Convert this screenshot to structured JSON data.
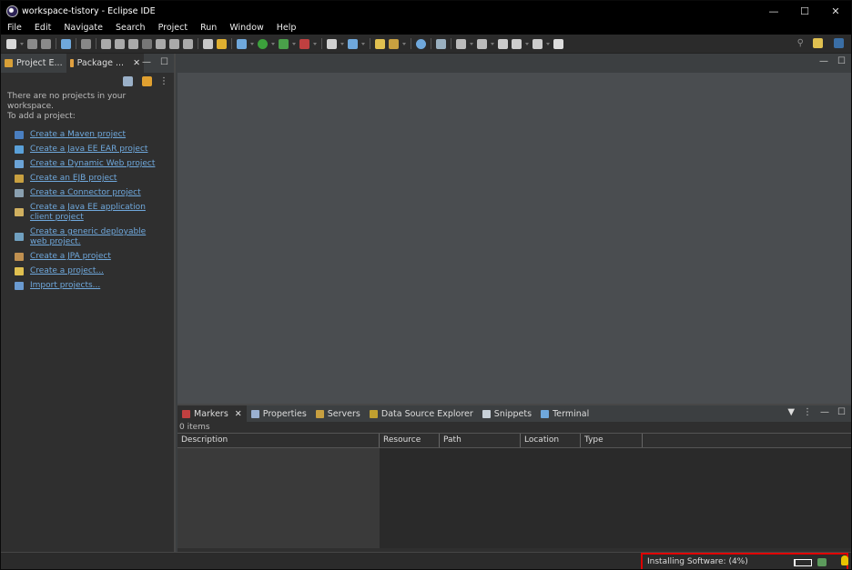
{
  "window": {
    "title": "workspace-tistory - Eclipse IDE",
    "controls": [
      "—",
      "☐",
      "✕"
    ]
  },
  "menu": [
    "File",
    "Edit",
    "Navigate",
    "Search",
    "Project",
    "Run",
    "Window",
    "Help"
  ],
  "left_panel": {
    "tabs": [
      {
        "label": "Project E..."
      },
      {
        "label": "Package ...",
        "close": "✕"
      }
    ],
    "controls": [
      "—",
      "☐"
    ],
    "toolbar_menu": "⋮",
    "empty_message": [
      "There are no projects in your workspace.",
      "To add a project:"
    ],
    "links": [
      {
        "label": "Create a Maven project",
        "icon": "maven-icon",
        "color": "#4a7fc1"
      },
      {
        "label": "Create a Java EE EAR project",
        "icon": "ear-icon",
        "color": "#5aa0d8"
      },
      {
        "label": "Create a Dynamic Web project",
        "icon": "web-icon",
        "color": "#6ba3d6"
      },
      {
        "label": "Create an EJB project",
        "icon": "ejb-icon",
        "color": "#c8a040"
      },
      {
        "label": "Create a Connector project",
        "icon": "connector-icon",
        "color": "#8aa0b0"
      },
      {
        "label": "Create a Java EE application client project",
        "icon": "appclient-icon",
        "color": "#d0b060"
      },
      {
        "label": "Create a generic deployable web project.",
        "icon": "webdeploy-icon",
        "color": "#70a0c0"
      },
      {
        "label": "Create a JPA project",
        "icon": "jpa-icon",
        "color": "#c09050"
      },
      {
        "label": "Create a project...",
        "icon": "project-icon",
        "color": "#e0c050"
      },
      {
        "label": "Import projects...",
        "icon": "import-icon",
        "color": "#6a9ad0"
      }
    ]
  },
  "editor": {
    "controls": [
      "—",
      "☐"
    ]
  },
  "bottom_panel": {
    "tabs": [
      {
        "label": "Markers",
        "icon": "markers-icon",
        "close": "✕"
      },
      {
        "label": "Properties",
        "icon": "properties-icon"
      },
      {
        "label": "Servers",
        "icon": "servers-icon"
      },
      {
        "label": "Data Source Explorer",
        "icon": "datasource-icon"
      },
      {
        "label": "Snippets",
        "icon": "snippets-icon"
      },
      {
        "label": "Terminal",
        "icon": "terminal-icon"
      }
    ],
    "controls": [
      "⋮",
      "—",
      "☐"
    ],
    "count": "0 items",
    "columns": [
      "Description",
      "Resource",
      "Path",
      "Location",
      "Type"
    ]
  },
  "status": {
    "text": "Installing Software: (4%)",
    "progress": 0.04
  }
}
